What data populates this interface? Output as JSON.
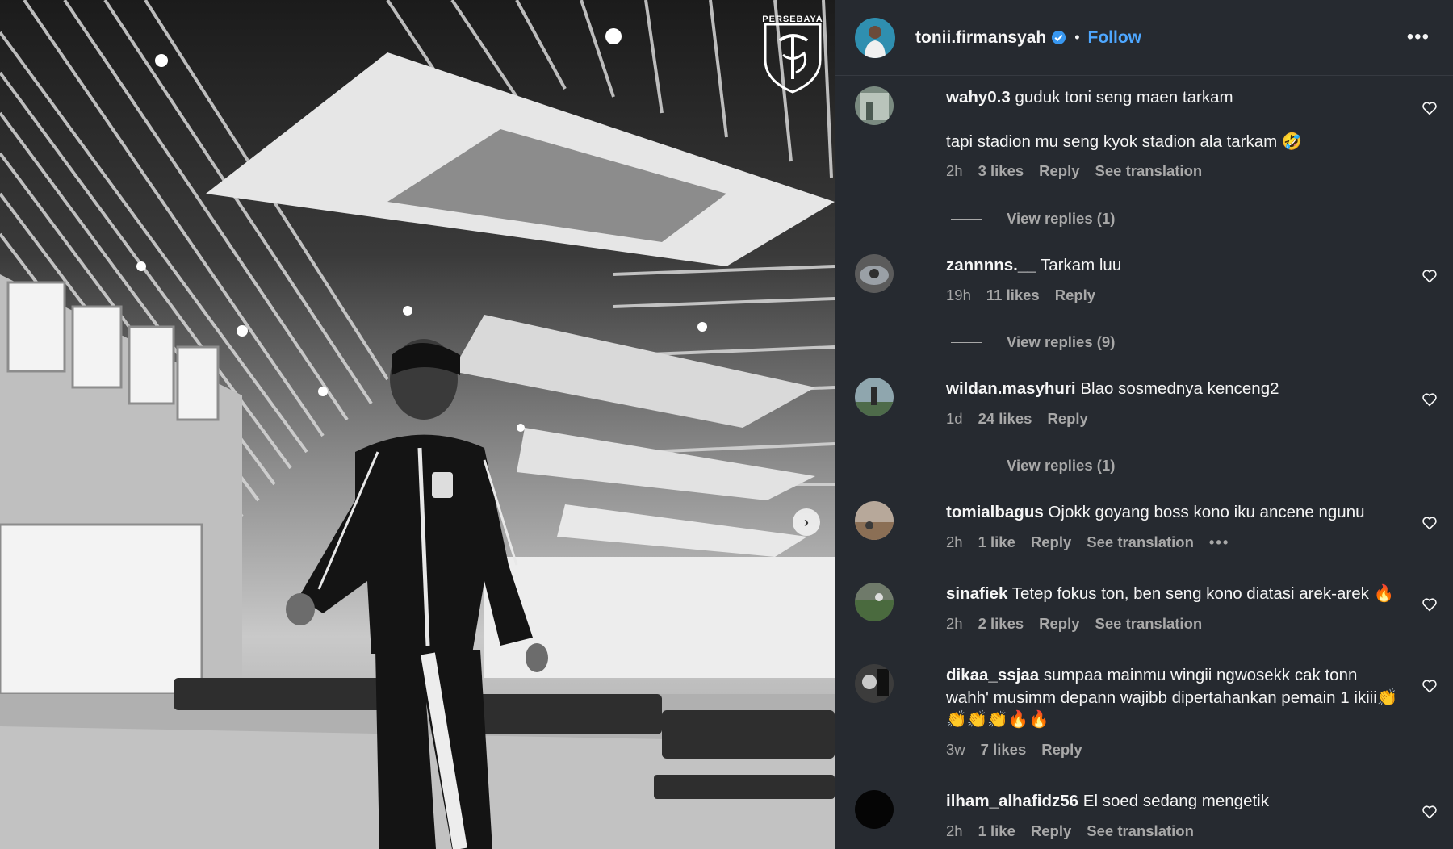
{
  "post": {
    "username": "tonii.firmansyah",
    "separator": "•",
    "follow_label": "Follow",
    "more_label": "•••",
    "next_label": "›",
    "crest_text": "PERSEBAYA"
  },
  "comments": [
    {
      "username": "wahy0.3",
      "text": "guduk toni seng maen tarkam",
      "extra_text": "tapi stadion mu seng kyok stadion ala tarkam 🤣",
      "time": "2h",
      "likes": "3 likes",
      "reply": "Reply",
      "translation": "See translation",
      "view_replies": "View replies (1)"
    },
    {
      "username": "zannnns.__",
      "text": "Tarkam luu",
      "time": "19h",
      "likes": "11 likes",
      "reply": "Reply",
      "view_replies": "View replies (9)"
    },
    {
      "username": "wildan.masyhuri",
      "text": "Blao sosmednya kenceng2",
      "time": "1d",
      "likes": "24 likes",
      "reply": "Reply",
      "view_replies": "View replies (1)"
    },
    {
      "username": "tomialbagus",
      "text": "Ojokk goyang boss kono iku ancene ngunu",
      "time": "2h",
      "likes": "1 like",
      "reply": "Reply",
      "translation": "See translation",
      "options": "•••"
    },
    {
      "username": "sinafiek",
      "text": "Tetep fokus ton, ben seng kono diatasi arek-arek 🔥",
      "time": "2h",
      "likes": "2 likes",
      "reply": "Reply",
      "translation": "See translation"
    },
    {
      "username": "dikaa_ssjaa",
      "text": "sumpaa mainmu wingii ngwosekk cak tonn wahh' musimm depann wajibb dipertahankan pemain 1 ikiii👏👏👏👏🔥🔥",
      "time": "3w",
      "likes": "7 likes",
      "reply": "Reply"
    },
    {
      "username": "ilham_alhafidz56",
      "text": "El soed sedang mengetik",
      "time": "2h",
      "likes": "1 like",
      "reply": "Reply",
      "translation": "See translation"
    }
  ],
  "colors": {
    "panel_bg": "#262a30",
    "text_primary": "#f5f5f5",
    "text_secondary": "#a8a8a8",
    "link_blue": "#4ea7ff"
  },
  "icons": [
    "verified-badge-icon",
    "more-options-icon",
    "heart-icon",
    "chevron-right-icon",
    "persebaya-crest-logo"
  ]
}
